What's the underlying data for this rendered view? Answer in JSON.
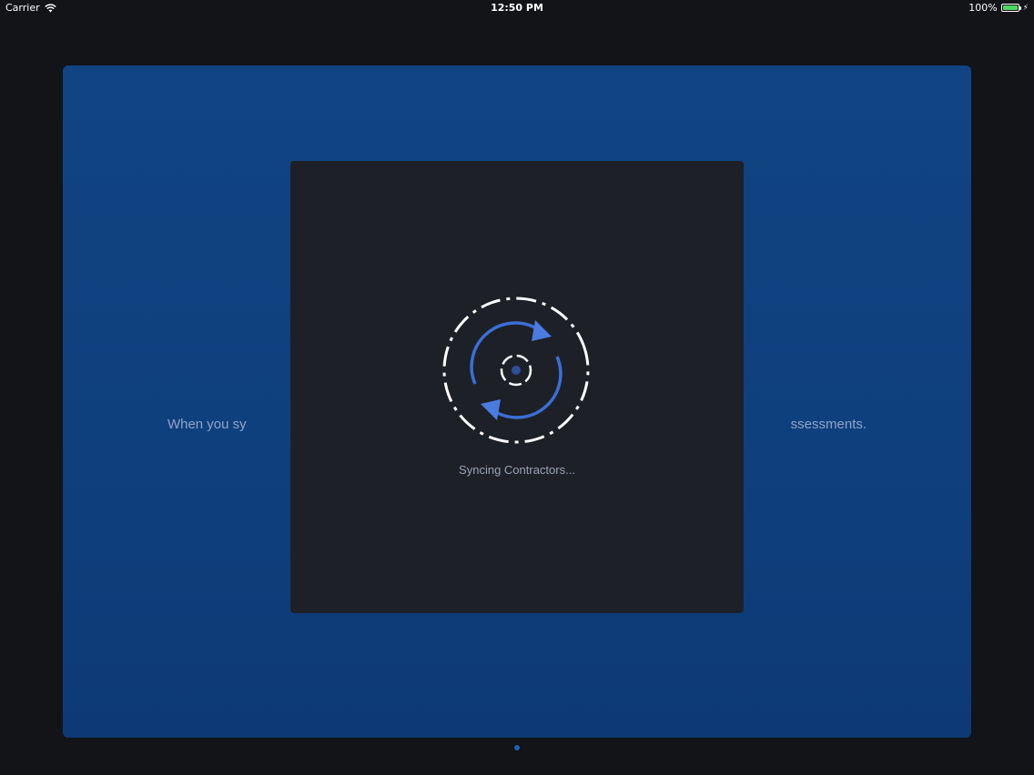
{
  "status_bar": {
    "carrier": "Carrier",
    "time": "12:50 PM",
    "battery": "100%"
  },
  "card": {
    "text_left": "When you sy",
    "text_right": "ssessments."
  },
  "modal": {
    "label": "Syncing Contractors..."
  },
  "colors": {
    "accent": "#3b6fd6",
    "card": "#114483",
    "modal": "#1e2028"
  }
}
